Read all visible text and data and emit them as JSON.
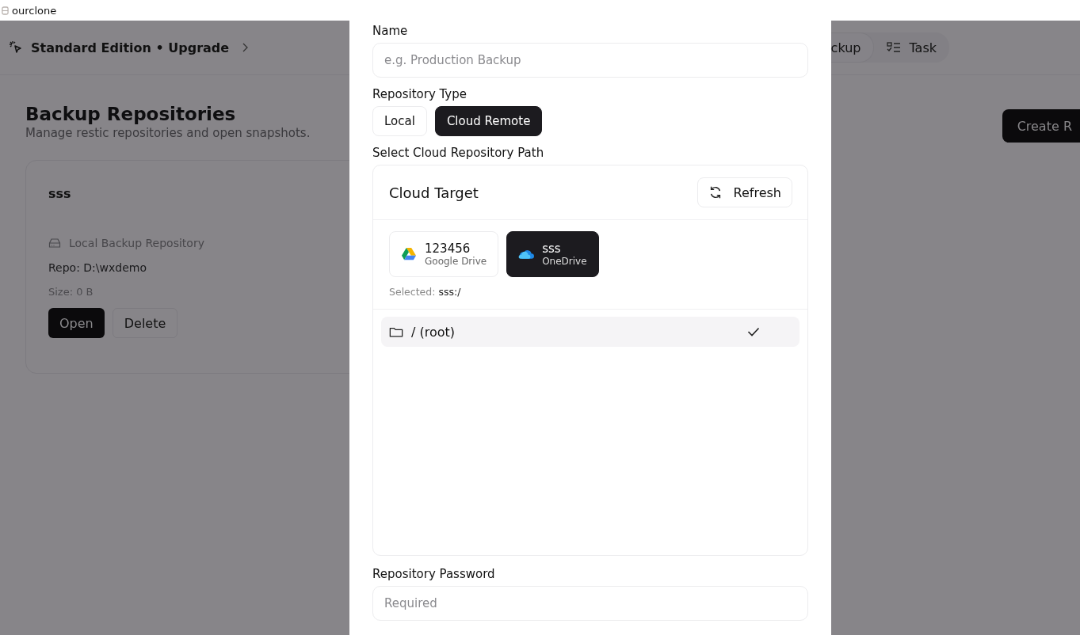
{
  "window": {
    "title": "ourclone"
  },
  "header": {
    "edition": "Standard Edition • Upgrade"
  },
  "nav": [
    {
      "label": "ckup",
      "kind": "backup"
    },
    {
      "label": "Task",
      "kind": "task"
    }
  ],
  "page": {
    "title": "Backup Repositories",
    "subtitle": "Manage restic repositories and open snapshots.",
    "create_button": "Create R"
  },
  "repositories": [
    {
      "name": "sss",
      "type": "Local Backup Repository",
      "repo": "Repo: D:\\wxdemo",
      "size": "Size: 0 B",
      "open": "Open",
      "delete": "Delete"
    }
  ],
  "dialog": {
    "name_label": "Name",
    "name_placeholder": "e.g. Production Backup",
    "type_label": "Repository Type",
    "types": [
      {
        "label": "Local",
        "selected": false
      },
      {
        "label": "Cloud Remote",
        "selected": true
      }
    ],
    "path_label": "Select Cloud Repository Path",
    "cloud": {
      "title": "Cloud Target",
      "refresh": "Refresh",
      "remotes": [
        {
          "name": "123456",
          "provider": "Google Drive",
          "kind": "gdrive",
          "selected": false
        },
        {
          "name": "sss",
          "provider": "OneDrive",
          "kind": "onedrive",
          "selected": true
        }
      ],
      "selected_label": "Selected:",
      "selected_value": "sss:/",
      "folders": [
        {
          "name": "/ (root)",
          "selected": true
        }
      ]
    },
    "password_label": "Repository Password",
    "password_placeholder": "Required"
  }
}
